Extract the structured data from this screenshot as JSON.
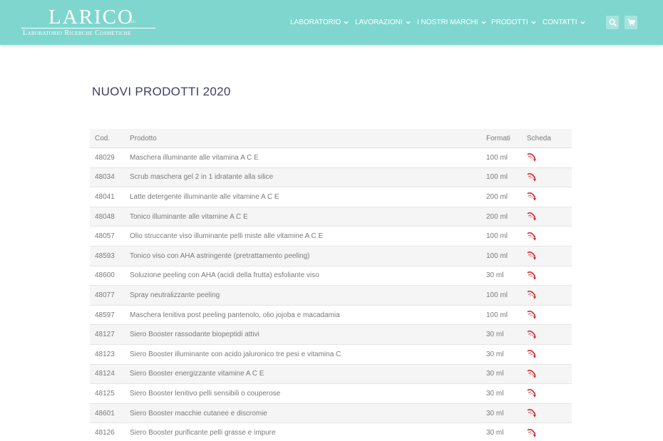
{
  "logo": {
    "name": "LARICO",
    "suffix": "s.r.l.",
    "tagline": "Laboratorio Ricerche Cosmetiche"
  },
  "nav": [
    {
      "label": "LABORATORIO"
    },
    {
      "label": "LAVORAZIONI"
    },
    {
      "label": "I NOSTRI MARCHI"
    },
    {
      "label": "PRODOTTI"
    },
    {
      "label": "CONTATTI"
    }
  ],
  "header_icons": {
    "search": "search-icon",
    "cart": "cart-icon"
  },
  "page": {
    "title": "NUOVI PRODOTTI 2020"
  },
  "table": {
    "headers": {
      "cod": "Cod.",
      "prodotto": "Prodotto",
      "formati": "Formati",
      "scheda": "Scheda"
    },
    "rows": [
      {
        "cod": "48029",
        "prodotto": "Maschera illuminante alle vitamina A C E",
        "formati": "100 ml"
      },
      {
        "cod": "48034",
        "prodotto": "Scrub maschera gel 2 in 1 idratante alla silice",
        "formati": "100 ml"
      },
      {
        "cod": "48041",
        "prodotto": "Latte detergente illuminante alle vitamine A C E",
        "formati": "200 ml"
      },
      {
        "cod": "48048",
        "prodotto": "Tonico illuminante alle vitamine A C E",
        "formati": "200 ml"
      },
      {
        "cod": "48057",
        "prodotto": "Olio struccante viso illuminante pelli miste alle vitamine A C E",
        "formati": "100 ml"
      },
      {
        "cod": "48593",
        "prodotto": "Tonico viso con AHA astringente (pretrattamento peeling)",
        "formati": "100 ml"
      },
      {
        "cod": "48600",
        "prodotto": "Soluzione peeling con AHA (acidi della frutta) esfoliante viso",
        "formati": "30 ml"
      },
      {
        "cod": "48077",
        "prodotto": "Spray neutralizzante peeling",
        "formati": "100 ml"
      },
      {
        "cod": "48597",
        "prodotto": "Maschera lenitiva post peeling pantenolo, olio jojoba e macadamia",
        "formati": "100 ml"
      },
      {
        "cod": "48127",
        "prodotto": "Siero Booster rassodante biopeptidi attivi",
        "formati": "30 ml"
      },
      {
        "cod": "48123",
        "prodotto": "Siero Booster illuminante con acido jaluronico tre pesi e vitamina C",
        "formati": "30 ml"
      },
      {
        "cod": "48124",
        "prodotto": "Siero Booster energizzante vitamine A C E",
        "formati": "30 ml"
      },
      {
        "cod": "48125",
        "prodotto": "Siero Booster lenitivo pelli sensibili o couperose",
        "formati": "30 ml"
      },
      {
        "cod": "48601",
        "prodotto": "Siero Booster macchie cutanee e discromie",
        "formati": "30 ml"
      },
      {
        "cod": "48126",
        "prodotto": "Siero Booster purificante pelli grasse e impure",
        "formati": "30 ml"
      }
    ]
  },
  "colors": {
    "header_bg": "#7fd6cf",
    "title": "#3e3e66",
    "text": "#7a7a7a",
    "pdf_icon": "#d8262c"
  }
}
